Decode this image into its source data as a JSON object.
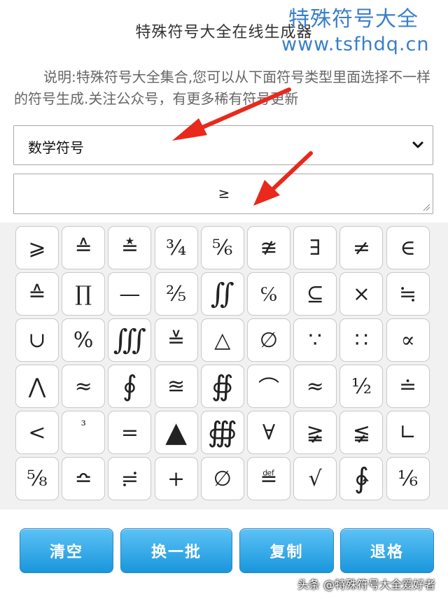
{
  "header": {
    "title": "特殊符号大全在线生成器",
    "watermark_name": "特殊符号大全",
    "watermark_url": "www.tsfhdq.cn"
  },
  "description": "说明:特殊符号大全集合,您可以从下面符号类型里面选择不一样的符号生成.关注公众号，有更多稀有符号更新",
  "category_select": {
    "value": "数学符号"
  },
  "output": {
    "value": "≥"
  },
  "symbols": [
    "⩾",
    "≙",
    "≛",
    "¾",
    "⅚",
    "≇",
    "∃",
    "≠",
    "∈",
    "≙",
    "∏",
    "—",
    "⅖",
    "∬",
    "℅",
    "⊆",
    "×",
    "≒",
    "∪",
    "%",
    "∭",
    "≚",
    "△",
    "∅",
    "∵",
    "∷",
    "∝",
    "⋀",
    "≈",
    "∮",
    "≊",
    "∯",
    "⌒",
    "≈",
    "½",
    "≐",
    "<",
    "³",
    "=",
    "▲",
    "∰",
    "∀",
    "≩",
    "≨",
    "∟",
    "⅝",
    "≏",
    "≓",
    "+",
    "∅",
    "≝",
    "√",
    "∳",
    "⅙"
  ],
  "actions": {
    "clear_label": "清空",
    "refresh_label": "换一批",
    "copy_label": "复制",
    "backspace_label": "退格"
  },
  "credit": "头条 @特殊符号大全爱好者",
  "colors": {
    "accent": "#1996dc",
    "watermark": "#3a7fc9",
    "arrow": "#e8291c"
  }
}
